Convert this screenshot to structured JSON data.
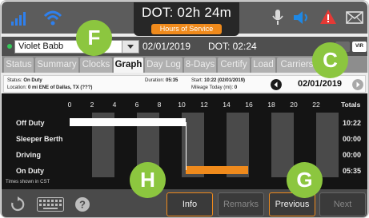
{
  "header": {
    "dot_title": "DOT: 02h 24m",
    "subtitle": "Hours of Service",
    "icons": [
      "signal-bars-icon",
      "wifi-icon",
      "microphone-icon",
      "speaker-icon",
      "warning-icon",
      "mail-icon"
    ]
  },
  "driver_row": {
    "driver_name": "Violet Babb",
    "date": "02/01/2019",
    "dot_time": "DOT: 02:24",
    "badge": "VIR"
  },
  "tabs": [
    {
      "label": "Status",
      "active": false
    },
    {
      "label": "Summary",
      "active": false
    },
    {
      "label": "Clocks",
      "active": false
    },
    {
      "label": "Graph",
      "active": true
    },
    {
      "label": "Day Log",
      "active": false
    },
    {
      "label": "8-Days",
      "active": false
    },
    {
      "label": "Certify",
      "active": false
    },
    {
      "label": "Load",
      "active": false
    },
    {
      "label": "Carriers",
      "active": false
    }
  ],
  "info_bar": {
    "status_label": "Status:",
    "status_value": "On Duty",
    "location_label": "Location:",
    "location_value": "0 mi ENE of Dallas, TX (???)",
    "duration_label": "Duration:",
    "duration_value": "05:35",
    "start_label": "Start:",
    "start_value": "10:22 (02/01/2019)",
    "mileage_label": "Mileage Today (mi):",
    "mileage_value": "0",
    "nav_date": "02/01/2019"
  },
  "graph": {
    "hour_labels": [
      "0",
      "2",
      "4",
      "6",
      "8",
      "10",
      "12",
      "14",
      "16",
      "18",
      "20",
      "22"
    ],
    "totals_label": "Totals",
    "rows": [
      {
        "label": "Off Duty",
        "total": "10:22"
      },
      {
        "label": "Sleeper Berth",
        "total": "00:00"
      },
      {
        "label": "Driving",
        "total": "00:00"
      },
      {
        "label": "On Duty",
        "total": "05:35"
      }
    ],
    "segments": [
      {
        "status": "Off Duty",
        "start_hour": 0,
        "end_hour": 10.37,
        "color": "#ffffff"
      },
      {
        "status": "On Duty",
        "start_hour": 10.37,
        "end_hour": 15.95,
        "color": "#ef8a1c"
      }
    ],
    "timezone_note": "Times shown in CST"
  },
  "footer": {
    "buttons": [
      {
        "label": "Info",
        "enabled": true
      },
      {
        "label": "Remarks",
        "enabled": false
      },
      {
        "label": "Previous",
        "enabled": true
      },
      {
        "label": "Next",
        "enabled": false
      }
    ],
    "icons": [
      "refresh-icon",
      "keyboard-icon",
      "help-icon"
    ]
  },
  "callouts": [
    "F",
    "C",
    "H",
    "G"
  ],
  "colors": {
    "accent": "#ef8a1c",
    "callout": "#8cc63f",
    "status_green": "#34c759",
    "alert_red": "#e53935",
    "speaker_blue": "#1e88e5"
  }
}
